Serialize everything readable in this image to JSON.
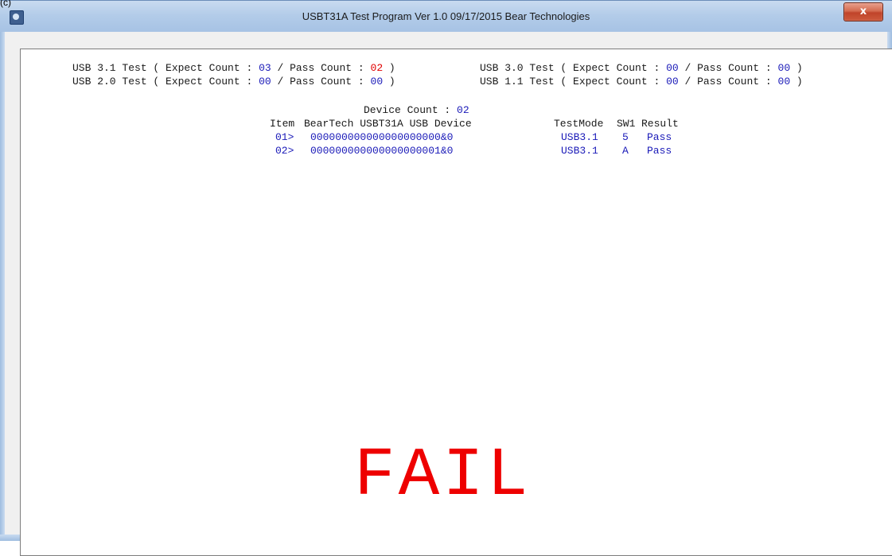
{
  "window": {
    "corner_label": "(c)",
    "title": "USBT31A Test Program Ver 1.0  09/17/2015 Bear Technologies",
    "close_glyph": "x"
  },
  "summary": {
    "usb31": {
      "label": "USB 3.1 Test",
      "expect": "03",
      "pass": "02"
    },
    "usb30": {
      "label": "USB 3.0 Test",
      "expect": "00",
      "pass": "00"
    },
    "usb20": {
      "label": "USB 2.0 Test",
      "expect": "00",
      "pass": "00"
    },
    "usb11": {
      "label": "USB 1.1 Test",
      "expect": "00",
      "pass": "00"
    },
    "expect_text": "Expect Count :",
    "pass_text": "Pass Count :"
  },
  "device": {
    "count_label": "Device Count :",
    "count": "02"
  },
  "table": {
    "headers": {
      "item": "Item",
      "device": "BearTech USBT31A USB Device",
      "testmode": "TestMode",
      "sw1": "SW1",
      "result": "Result"
    },
    "rows": [
      {
        "item": "01>",
        "device": "000000000000000000000&0",
        "testmode": "USB3.1",
        "sw1": "5",
        "result": "Pass"
      },
      {
        "item": "02>",
        "device": "000000000000000000001&0",
        "testmode": "USB3.1",
        "sw1": "A",
        "result": "Pass"
      }
    ]
  },
  "status": "FAIL",
  "colors": {
    "value_blue": "#1a1ab8",
    "fail_red": "#ee0000"
  }
}
